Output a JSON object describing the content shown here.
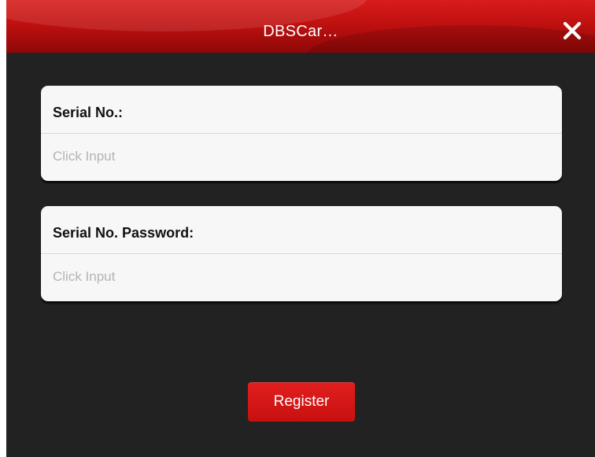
{
  "window": {
    "title": "DBSCar…"
  },
  "icons": {
    "close": "close-icon"
  },
  "form": {
    "serial_label": "Serial No.:",
    "serial_placeholder": "Click Input",
    "serial_value": "",
    "password_label": "Serial No. Password:",
    "password_placeholder": "Click Input",
    "password_value": ""
  },
  "actions": {
    "register_label": "Register"
  },
  "colors": {
    "titlebar": "#c01010",
    "background": "#222222",
    "card": "#f7f7f7",
    "button": "#d41616",
    "placeholder": "#b4b4b4"
  }
}
